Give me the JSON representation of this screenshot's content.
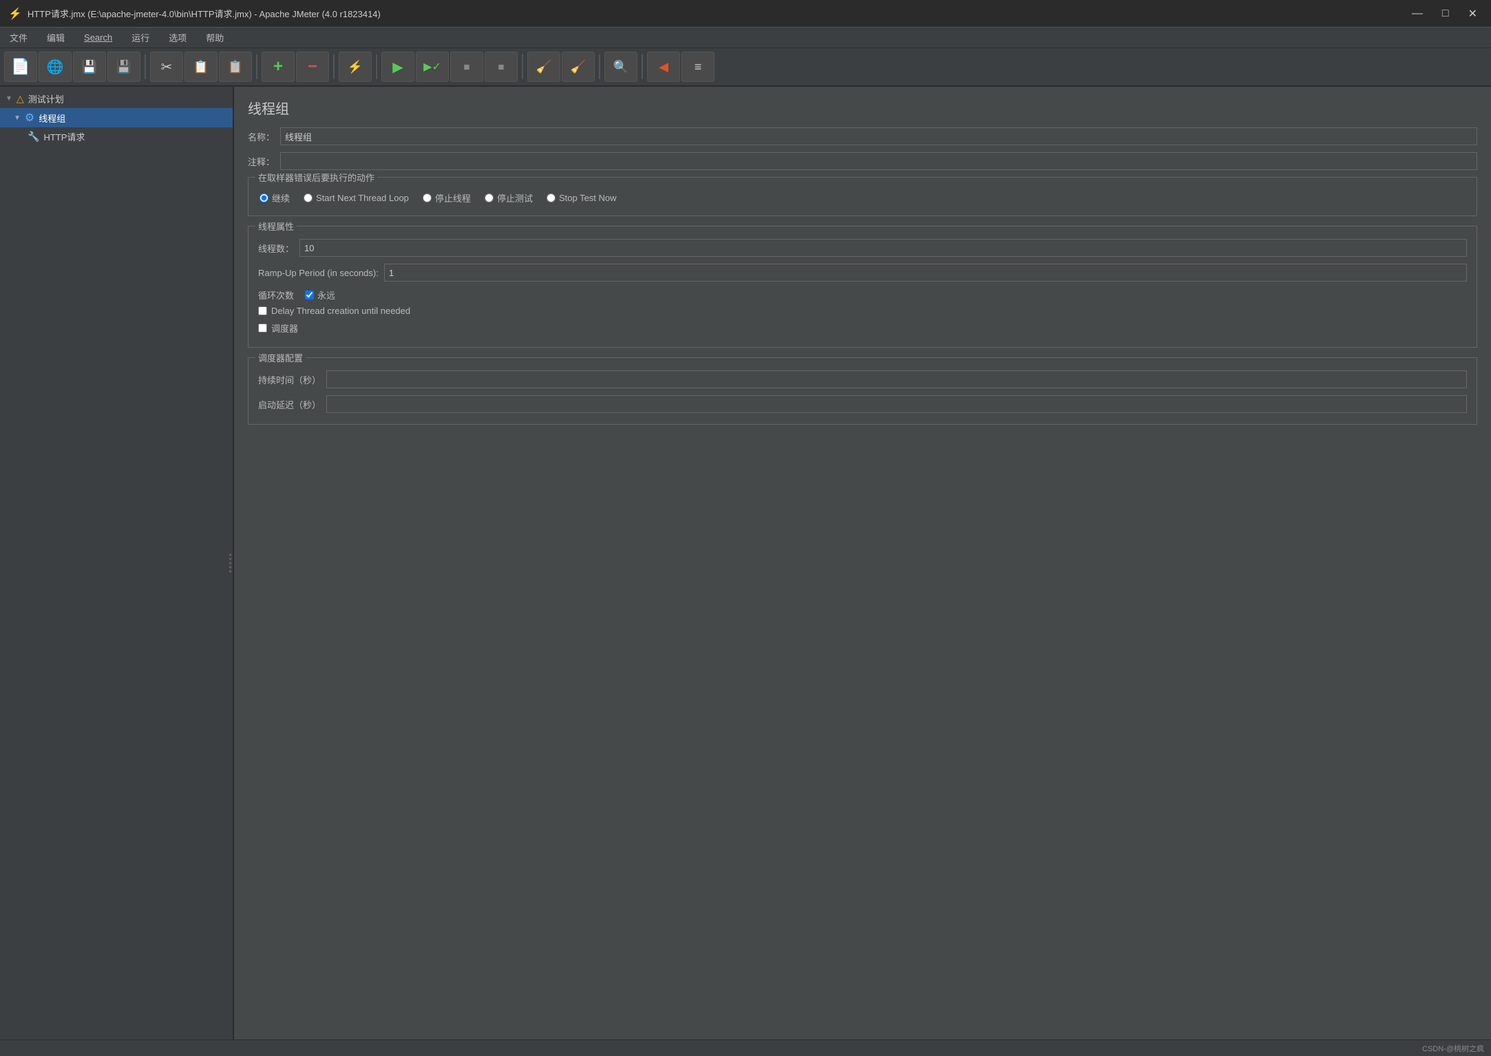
{
  "window": {
    "title": "HTTP请求.jmx (E:\\apache-jmeter-4.0\\bin\\HTTP请求.jmx) - Apache JMeter (4.0 r1823414)",
    "icon": "⚡"
  },
  "titleControls": {
    "minimize": "—",
    "maximize": "□",
    "close": "✕"
  },
  "menu": {
    "items": [
      "文件",
      "编辑",
      "Search",
      "运行",
      "选项",
      "帮助"
    ]
  },
  "toolbar": {
    "buttons": [
      {
        "name": "new",
        "icon": "📄",
        "label": "新建"
      },
      {
        "name": "open",
        "icon": "🌐",
        "label": "打开"
      },
      {
        "name": "save-as",
        "icon": "💾",
        "label": "另存为"
      },
      {
        "name": "save",
        "icon": "💾",
        "label": "保存"
      },
      {
        "name": "cut",
        "icon": "✂",
        "label": "剪切"
      },
      {
        "name": "copy",
        "icon": "📋",
        "label": "复制"
      },
      {
        "name": "paste",
        "icon": "📋",
        "label": "粘贴"
      },
      {
        "name": "add",
        "icon": "+",
        "label": "添加"
      },
      {
        "name": "remove",
        "icon": "−",
        "label": "删除"
      },
      {
        "name": "clear",
        "icon": "⚡",
        "label": "清除"
      },
      {
        "name": "run",
        "icon": "▶",
        "label": "运行"
      },
      {
        "name": "run-check",
        "icon": "▶",
        "label": "运行检查"
      },
      {
        "name": "stop",
        "icon": "⏹",
        "label": "停止"
      },
      {
        "name": "stop-force",
        "icon": "⏹",
        "label": "强制停止"
      },
      {
        "name": "clear-all",
        "icon": "🧹",
        "label": "全部清除"
      },
      {
        "name": "clear-results",
        "icon": "🧹",
        "label": "清除结果"
      },
      {
        "name": "search",
        "icon": "🔍",
        "label": "搜索"
      },
      {
        "name": "collapse",
        "icon": "◀",
        "label": "折叠"
      },
      {
        "name": "list",
        "icon": "≡",
        "label": "列表"
      }
    ]
  },
  "sidebar": {
    "items": [
      {
        "id": "test-plan",
        "label": "测试计划",
        "level": 0,
        "icon": "△",
        "arrow": "▼",
        "selected": false
      },
      {
        "id": "thread-group",
        "label": "线程组",
        "level": 1,
        "icon": "⚙",
        "arrow": "▼",
        "selected": true
      },
      {
        "id": "http-request",
        "label": "HTTP请求",
        "level": 2,
        "icon": "🔧",
        "arrow": "",
        "selected": false
      }
    ]
  },
  "content": {
    "pageTitle": "线程组",
    "nameLabel": "名称：",
    "nameValue": "线程组",
    "commentLabel": "注释：",
    "commentValue": "",
    "errorActionGroup": "在取样器错误后要执行的动作",
    "radioOptions": [
      {
        "id": "continue",
        "label": "继续",
        "checked": true
      },
      {
        "id": "start-next",
        "label": "Start Next Thread Loop",
        "checked": false
      },
      {
        "id": "stop-thread",
        "label": "停止线程",
        "checked": false
      },
      {
        "id": "stop-test",
        "label": "停止测试",
        "checked": false
      },
      {
        "id": "stop-now",
        "label": "Stop Test Now",
        "checked": false
      }
    ],
    "threadPropsGroup": "线程属性",
    "threadCountLabel": "线程数：",
    "threadCountValue": "10",
    "rampUpLabel": "Ramp-Up Period (in seconds):",
    "rampUpValue": "1",
    "loopLabel": "循环次数",
    "foreverLabel": "永远",
    "foreverChecked": true,
    "delayThreadLabel": "Delay Thread creation until needed",
    "delayThreadChecked": false,
    "schedulerLabel": "调度器",
    "schedulerChecked": false,
    "schedulerConfigGroup": "调度器配置",
    "durationLabel": "持续时间（秒）",
    "durationValue": "",
    "startDelayLabel": "启动延迟（秒）",
    "startDelayValue": ""
  },
  "statusBar": {
    "text": "CSDN-@桃树之疯"
  }
}
